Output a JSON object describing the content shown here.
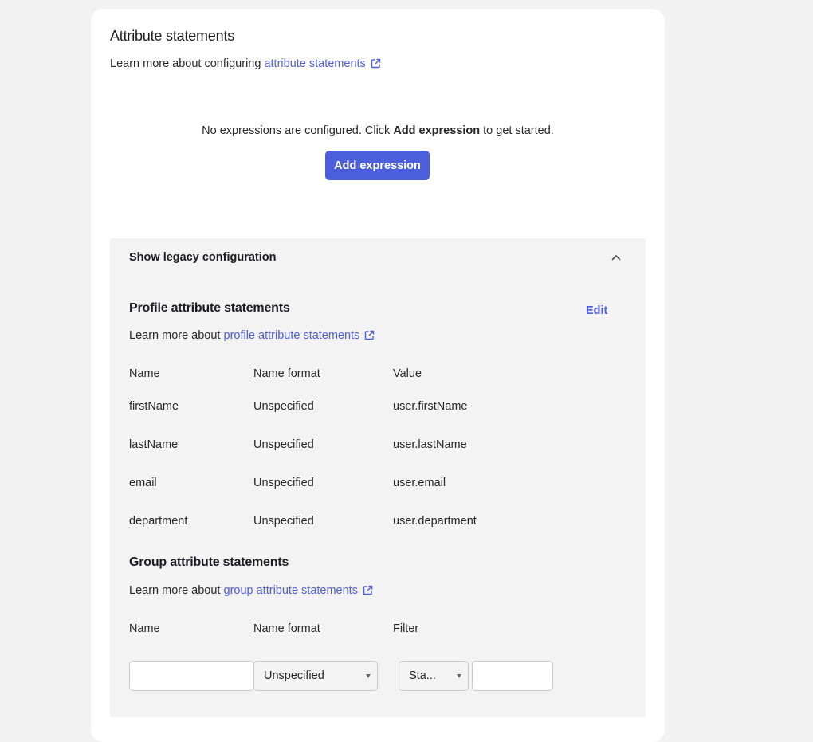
{
  "section": {
    "title": "Attribute statements",
    "learn_prefix": "Learn more about configuring ",
    "learn_link": "attribute statements"
  },
  "empty_state": {
    "text_before": "No expressions are configured. Click ",
    "text_bold": "Add expression",
    "text_after": " to get started.",
    "button_label": "Add expression"
  },
  "legacy": {
    "toggle_label": "Show legacy configuration",
    "profile": {
      "title": "Profile attribute statements",
      "edit_label": "Edit",
      "learn_prefix": "Learn more about ",
      "learn_link": "profile attribute statements",
      "columns": [
        "Name",
        "Name format",
        "Value"
      ],
      "rows": [
        [
          "firstName",
          "Unspecified",
          "user.firstName"
        ],
        [
          "lastName",
          "Unspecified",
          "user.lastName"
        ],
        [
          "email",
          "Unspecified",
          "user.email"
        ],
        [
          "department",
          "Unspecified",
          "user.department"
        ]
      ]
    },
    "group": {
      "title": "Group attribute statements",
      "learn_prefix": "Learn more about ",
      "learn_link": "group attribute statements",
      "columns": [
        "Name",
        "Name format",
        "Filter"
      ],
      "name_value": "",
      "name_format_value": "Unspecified",
      "filter_type_value": "Sta...",
      "filter_value": ""
    }
  },
  "colors": {
    "accent": "#4b5fdc",
    "link": "#4f5fd9",
    "panel_bg": "#f3f3f3",
    "page_bg": "#f2f2f2"
  },
  "icons": {
    "external_link": "external-link-icon",
    "collapse": "chevron-up-icon",
    "dropdown": "caret-down-icon"
  }
}
